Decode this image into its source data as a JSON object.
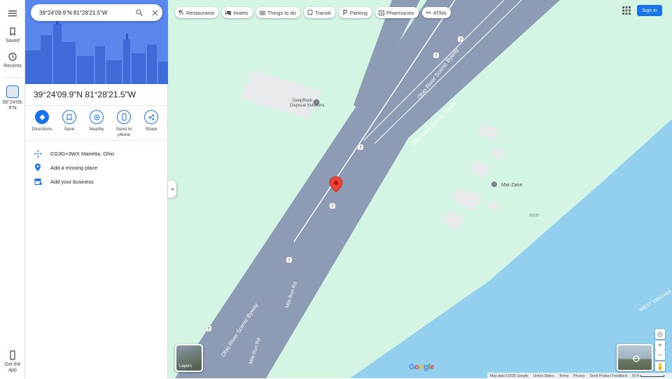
{
  "search": {
    "value": "39°24'09.9\"N 81°28'21.5\"W"
  },
  "rail": {
    "saved_label": "Saved",
    "recents_label": "Recents",
    "recent_place_label": "39°24'09.9\"N",
    "get_app_label": "Get the app"
  },
  "place": {
    "title": "39°24'09.9\"N 81°28'21.5\"W",
    "plus_code": "CG3G+3WX Marietta, Ohio",
    "add_missing_place": "Add a missing place",
    "add_business": "Add your business"
  },
  "actions": [
    {
      "label": "Directions",
      "icon": "directions-icon"
    },
    {
      "label": "Save",
      "icon": "bookmark-icon"
    },
    {
      "label": "Nearby",
      "icon": "nearby-icon"
    },
    {
      "label": "Send to phone",
      "icon": "phone-icon"
    },
    {
      "label": "Share",
      "icon": "share-icon"
    }
  ],
  "chips": [
    {
      "label": "Restaurants",
      "icon": "restaurant-icon"
    },
    {
      "label": "Hotels",
      "icon": "hotel-icon"
    },
    {
      "label": "Things to do",
      "icon": "camera-icon"
    },
    {
      "label": "Transit",
      "icon": "transit-icon"
    },
    {
      "label": "Parking",
      "icon": "parking-icon"
    },
    {
      "label": "Pharmacies",
      "icon": "pharmacy-icon"
    },
    {
      "label": "ATMs",
      "icon": "atm-icon"
    }
  ],
  "header": {
    "sign_in_label": "Sign in"
  },
  "map": {
    "labels": {
      "road1": "Ohio River Scenic Byway",
      "road2": "Ohio River Scenic Byway",
      "road3": "Mile Run Rd",
      "road4": "Mile Run Rd",
      "road5": "Ohio River Scenic Byway",
      "poi1": "DeepRock",
      "poi1b": "Disposal Solutions",
      "poi2": "Mar-Zane",
      "water": "WEST VIRGINIA",
      "route_shield": "7",
      "zip": "20220"
    },
    "layers_label": "Layers",
    "logo": "Google",
    "colors": {
      "land": "#d4f5e3",
      "road": "#8e9bb5",
      "water": "#93cfee",
      "pin": "#ea4335"
    }
  },
  "footer": {
    "map_data": "Map data ©2025 Google",
    "country": "United States",
    "terms": "Terms",
    "privacy": "Privacy",
    "feedback": "Send Product Feedback",
    "scale": "50 ft"
  }
}
